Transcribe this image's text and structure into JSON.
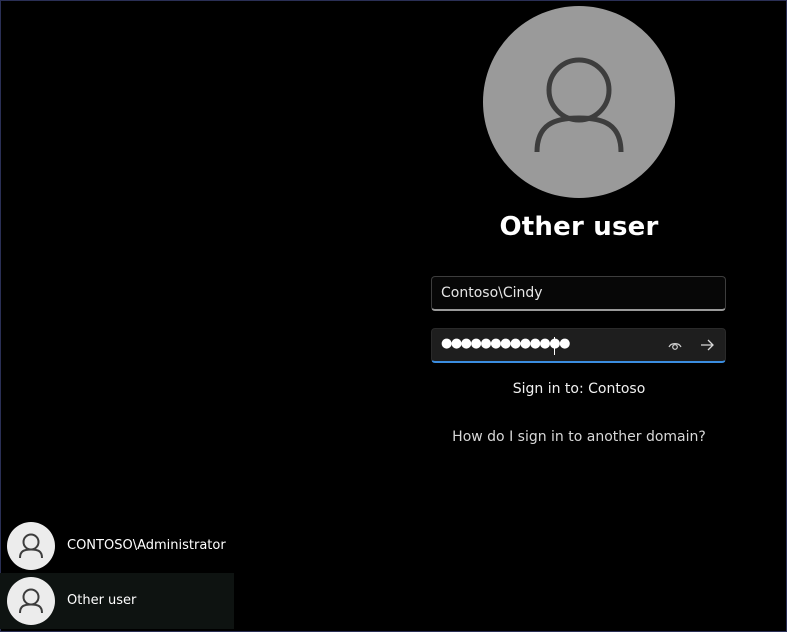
{
  "selected_user": {
    "name": "Other user",
    "avatar_icon": "person-icon"
  },
  "form": {
    "username_value": "Contoso\\Cindy",
    "password_mask": "●●●●●●●●●●●●●",
    "reveal_icon": "eye-icon",
    "submit_icon": "arrow-right-icon",
    "sign_in_to": "Sign in to: Contoso",
    "other_domain_link": "How do I sign in to another domain?"
  },
  "user_list": [
    {
      "name": "CONTOSO\\Administrator",
      "avatar_icon": "person-icon",
      "selected": false
    },
    {
      "name": "Other user",
      "avatar_icon": "person-icon",
      "selected": true
    }
  ],
  "colors": {
    "background": "#000000",
    "avatar_large": "#9a9a9a",
    "focus_accent": "#3b8de0",
    "selected_tile": "#0e1311"
  }
}
